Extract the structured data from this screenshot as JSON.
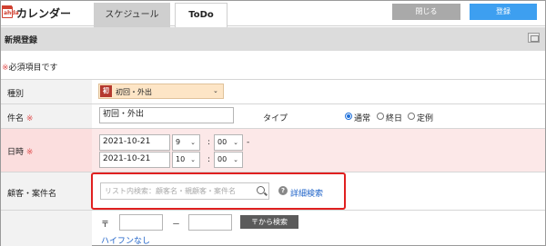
{
  "header": {
    "app_title": "カレンダー",
    "logo_icon_text": "ahda",
    "tabs": [
      {
        "label": "スケジュール",
        "active": true
      },
      {
        "label": "ToDo",
        "active": false
      }
    ],
    "close_label": "閉じる",
    "register_label": "登録"
  },
  "section": {
    "title": "新規登録"
  },
  "required_note": {
    "mark": "※",
    "text": "必須項目です"
  },
  "form": {
    "type": {
      "label": "種別",
      "badge": "初",
      "value": "初回・外出"
    },
    "subject": {
      "label": "件名",
      "required_mark": "※",
      "value": "初回・外出"
    },
    "schedule_type": {
      "label": "タイプ",
      "options": [
        {
          "label": "通常",
          "selected": true
        },
        {
          "label": "終日",
          "selected": false
        },
        {
          "label": "定例",
          "selected": false
        }
      ]
    },
    "datetime": {
      "label": "日時",
      "required_mark": "※",
      "start": {
        "date": "2021-10-21",
        "hour": "9",
        "minute": "00"
      },
      "end": {
        "date": "2021-10-21",
        "hour": "10",
        "minute": "00"
      },
      "time_separator": ":",
      "range_separator": "-"
    },
    "customer": {
      "label": "顧客・案件名",
      "search_placeholder": "リスト内検索：顧客名・親顧客・案件名",
      "detail_search": "詳細検索"
    },
    "postal": {
      "symbol": "〒",
      "dash": "－",
      "search_button": "〒から検索",
      "no_hyphen_link": "ハイフンなし"
    }
  },
  "colors": {
    "accent_blue": "#3d9ff0",
    "required_red": "#e05050",
    "highlight_red": "#e02020",
    "link_blue": "#1d62c8"
  }
}
